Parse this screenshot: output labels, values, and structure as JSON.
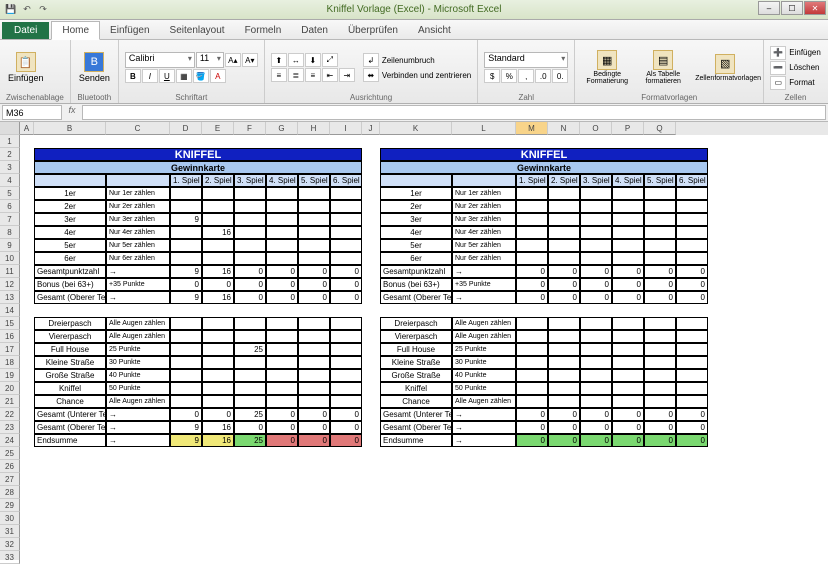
{
  "window": {
    "title": "Kniffel Vorlage (Excel) - Microsoft Excel",
    "qat": {
      "save": "💾",
      "undo": "↶",
      "redo": "↷"
    }
  },
  "tabs": {
    "file": "Datei",
    "items": [
      "Home",
      "Einfügen",
      "Seitenlayout",
      "Formeln",
      "Daten",
      "Überprüfen",
      "Ansicht"
    ],
    "active": 0
  },
  "ribbon": {
    "clipboard": {
      "label": "Zwischenablage",
      "paste": "Einfügen"
    },
    "bluetooth": {
      "label": "Bluetooth",
      "send": "Senden"
    },
    "font": {
      "label": "Schriftart",
      "name": "Calibri",
      "size": "11"
    },
    "align": {
      "label": "Ausrichtung",
      "wrap": "Zeilenumbruch",
      "merge": "Verbinden und zentrieren"
    },
    "number": {
      "label": "Zahl",
      "format": "Standard"
    },
    "styles": {
      "label": "Formatvorlagen",
      "cond": "Bedingte Formatierung",
      "table": "Als Tabelle formatieren",
      "cell": "Zellenformatvorlagen"
    },
    "cells": {
      "label": "Zellen",
      "insert": "Einfügen",
      "delete": "Löschen",
      "format": "Format"
    }
  },
  "namebox": "M36",
  "columns": [
    "A",
    "B",
    "C",
    "D",
    "E",
    "F",
    "G",
    "H",
    "I",
    "J",
    "K",
    "L",
    "M",
    "N",
    "O",
    "P",
    "Q"
  ],
  "selected_col": "M",
  "kniffel": {
    "title": "KNIFFEL",
    "subtitle": "Gewinnkarte",
    "game_headers": [
      "1. Spiel",
      "2. Spiel",
      "3. Spiel",
      "4. Spiel",
      "5. Spiel",
      "6. Spiel"
    ],
    "upper": [
      {
        "label": "1er",
        "hint": "Nur 1er zählen"
      },
      {
        "label": "2er",
        "hint": "Nur 2er zählen"
      },
      {
        "label": "3er",
        "hint": "Nur 3er zählen"
      },
      {
        "label": "4er",
        "hint": "Nur 4er zählen"
      },
      {
        "label": "5er",
        "hint": "Nur 5er zählen"
      },
      {
        "label": "6er",
        "hint": "Nur 6er zählen"
      }
    ],
    "upper_vals_left": [
      [
        "",
        "",
        "",
        "",
        "",
        ""
      ],
      [
        "",
        "",
        "",
        "",
        "",
        ""
      ],
      [
        "9",
        "",
        "",
        "",
        "",
        ""
      ],
      [
        "",
        "16",
        "",
        "",
        "",
        ""
      ],
      [
        "",
        "",
        "",
        "",
        "",
        ""
      ],
      [
        "",
        "",
        "",
        "",
        "",
        ""
      ]
    ],
    "upper_sums": [
      {
        "label": "Gesamtpunktzahl",
        "arrow": "→"
      },
      {
        "label": "Bonus (bei 63+)",
        "hint": "+35 Punkte"
      },
      {
        "label": "Gesamt (Oberer Teil)",
        "arrow": "→"
      }
    ],
    "upper_sum_vals_left": [
      [
        "9",
        "16",
        "0",
        "0",
        "0",
        "0"
      ],
      [
        "0",
        "0",
        "0",
        "0",
        "0",
        "0"
      ],
      [
        "9",
        "16",
        "0",
        "0",
        "0",
        "0"
      ]
    ],
    "upper_sum_vals_right": [
      [
        "0",
        "0",
        "0",
        "0",
        "0",
        "0"
      ],
      [
        "0",
        "0",
        "0",
        "0",
        "0",
        "0"
      ],
      [
        "0",
        "0",
        "0",
        "0",
        "0",
        "0"
      ]
    ],
    "lower": [
      {
        "label": "Dreierpasch",
        "hint": "Alle Augen zählen"
      },
      {
        "label": "Viererpasch",
        "hint": "Alle Augen zählen"
      },
      {
        "label": "Full House",
        "hint": "25 Punkte"
      },
      {
        "label": "Kleine Straße",
        "hint": "30 Punkte"
      },
      {
        "label": "Große Straße",
        "hint": "40 Punkte"
      },
      {
        "label": "Kniffel",
        "hint": "50 Punkte"
      },
      {
        "label": "Chance",
        "hint": "Alle Augen zählen"
      }
    ],
    "lower_vals_left": [
      [
        "",
        "",
        "",
        "",
        "",
        ""
      ],
      [
        "",
        "",
        "",
        "",
        "",
        ""
      ],
      [
        "",
        "",
        "25",
        "",
        "",
        ""
      ],
      [
        "",
        "",
        "",
        "",
        "",
        ""
      ],
      [
        "",
        "",
        "",
        "",
        "",
        ""
      ],
      [
        "",
        "",
        "",
        "",
        "",
        ""
      ],
      [
        "",
        "",
        "",
        "",
        "",
        ""
      ]
    ],
    "lower_sums": [
      {
        "label": "Gesamt (Unterer Teil)",
        "arrow": "→"
      },
      {
        "label": "Gesamt (Oberer Teil)",
        "arrow": "→"
      },
      {
        "label": "Endsumme",
        "arrow": "→"
      }
    ],
    "lower_sum_vals_left": [
      [
        "0",
        "0",
        "25",
        "0",
        "0",
        "0"
      ],
      [
        "9",
        "16",
        "0",
        "0",
        "0",
        "0"
      ],
      [
        "9",
        "16",
        "25",
        "0",
        "0",
        "0"
      ]
    ],
    "lower_sum_vals_right": [
      [
        "0",
        "0",
        "0",
        "0",
        "0",
        "0"
      ],
      [
        "0",
        "0",
        "0",
        "0",
        "0",
        "0"
      ],
      [
        "0",
        "0",
        "0",
        "0",
        "0",
        "0"
      ]
    ],
    "end_colors_left": [
      "yellow",
      "yellow",
      "green",
      "red",
      "red",
      "red"
    ],
    "end_colors_right": [
      "green",
      "green",
      "green",
      "green",
      "green",
      "green"
    ]
  }
}
